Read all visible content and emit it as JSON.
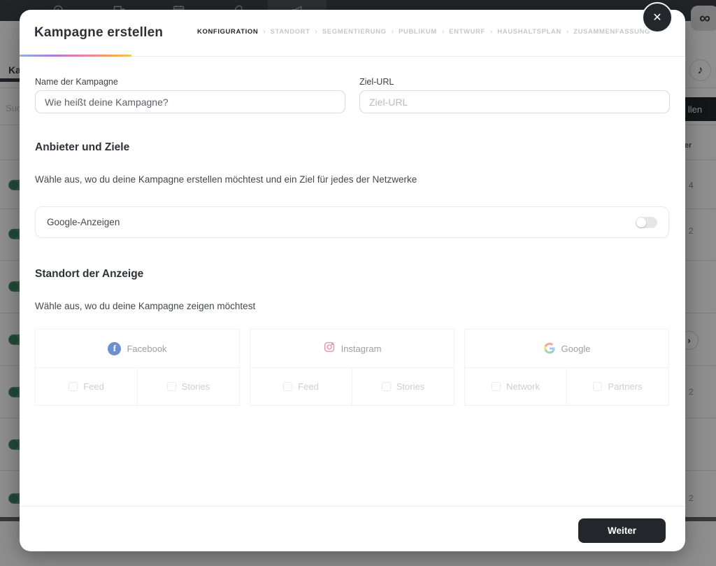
{
  "topbar": {
    "icons": [
      "analytics-search",
      "chat",
      "calendar",
      "link",
      "megaphone"
    ],
    "logo_glyph": "∞"
  },
  "background": {
    "tab_label": "Kam",
    "search_text": "Suc",
    "right_button_label": "llen",
    "column_header": "nver",
    "tiktok_glyph": "♪",
    "chevron_glyph": "›",
    "values": [
      "4",
      "2",
      "2",
      "2"
    ]
  },
  "modal": {
    "title": "Kampagne erstellen",
    "close_glyph": "✕",
    "steps": [
      {
        "label": "KONFIGURATION"
      },
      {
        "label": "STANDORT"
      },
      {
        "label": "SEGMENTIERUNG"
      },
      {
        "label": "PUBLIKUM"
      },
      {
        "label": "ENTWURF"
      },
      {
        "label": "HAUSHALTSPLAN"
      },
      {
        "label": "ZUSAMMENFASSUNG"
      }
    ],
    "step_separator": "›",
    "fields": {
      "name_label": "Name der Kampagne",
      "name_placeholder": "Wie heißt deine Kampagne?",
      "url_label": "Ziel-URL",
      "url_placeholder": "Ziel-URL"
    },
    "providers_section": {
      "title": "Anbieter und Ziele",
      "description": "Wähle aus, wo du deine Kampagne erstellen möchtest und ein Ziel für jedes der Netzwerke",
      "provider_label": "Google-Anzeigen",
      "toggle_state": "off"
    },
    "placement_section": {
      "title": "Standort der Anzeige",
      "description": "Wähle aus, wo du deine Kampagne zeigen möchtest",
      "networks": [
        {
          "name": "Facebook",
          "icon_glyph": "f",
          "placements": [
            "Feed",
            "Stories"
          ]
        },
        {
          "name": "Instagram",
          "placements": [
            "Feed",
            "Stories"
          ]
        },
        {
          "name": "Google",
          "placements": [
            "Network",
            "Partners"
          ]
        }
      ]
    },
    "footer": {
      "next_label": "Weiter"
    }
  },
  "colors": {
    "accent_dark": "#23272b",
    "toggle_on_green": "#4f9a78",
    "facebook_blue": "#6c8fce",
    "instagram_pink": "#e78fa3",
    "gradient": [
      "#8cb2e0",
      "#b07bd6",
      "#e57fb0",
      "#eda05f",
      "#f2c94c"
    ]
  }
}
